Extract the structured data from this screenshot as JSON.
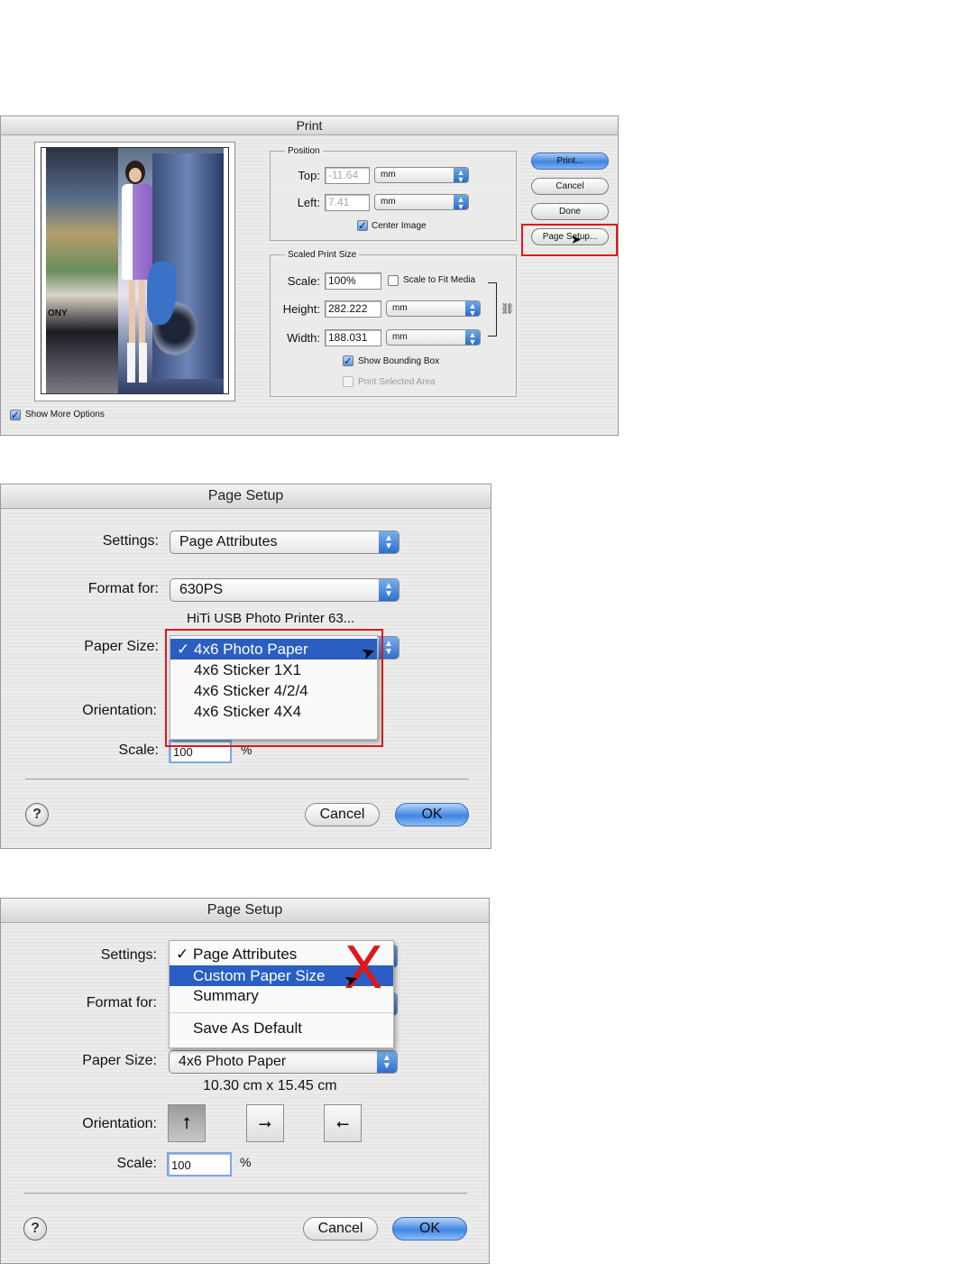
{
  "print_dialog": {
    "title": "Print",
    "show_more_options": "Show More Options",
    "position": {
      "group_title": "Position",
      "top_label": "Top:",
      "top_value": "-11.64",
      "top_unit": "mm",
      "left_label": "Left:",
      "left_value": "7.41",
      "left_unit": "mm",
      "center_image": "Center Image"
    },
    "scaled_size": {
      "group_title": "Scaled Print Size",
      "scale_label": "Scale:",
      "scale_value": "100%",
      "scale_to_fit": "Scale to Fit Media",
      "height_label": "Height:",
      "height_value": "282.222",
      "height_unit": "mm",
      "width_label": "Width:",
      "width_value": "188.031",
      "width_unit": "mm",
      "show_bounding_box": "Show Bounding Box",
      "print_selected_area": "Print Selected Area"
    },
    "buttons": {
      "print": "Print...",
      "cancel": "Cancel",
      "done": "Done",
      "page_setup": "Page Setup..."
    },
    "preview_brand_text": "ONY"
  },
  "page_setup_1": {
    "title": "Page Setup",
    "settings_label": "Settings:",
    "settings_value": "Page Attributes",
    "format_label": "Format for:",
    "format_value": "630PS",
    "printer_desc": "HiTi USB Photo Printer 63...",
    "paper_label": "Paper Size:",
    "paper_options": [
      "4x6 Photo Paper",
      "4x6 Sticker 1X1",
      "4x6 Sticker 4/2/4",
      "4x6 Sticker 4X4"
    ],
    "checkmark": "✓",
    "orientation_label": "Orientation:",
    "scale_label": "Scale:",
    "scale_value": "100",
    "percent": "%",
    "help": "?",
    "cancel": "Cancel",
    "ok": "OK"
  },
  "page_setup_2": {
    "title": "Page Setup",
    "settings_label": "Settings:",
    "settings_options": [
      "Page Attributes",
      "Custom Paper Size",
      "Summary",
      "Save As Default"
    ],
    "checkmark": "✓",
    "format_label": "Format for:",
    "paper_label": "Paper Size:",
    "paper_value": "4x6 Photo Paper",
    "paper_dims": "10.30 cm x 15.45 cm",
    "orientation_label": "Orientation:",
    "scale_label": "Scale:",
    "scale_value": "100",
    "percent": "%",
    "help": "?",
    "cancel": "Cancel",
    "ok": "OK",
    "annotation_mark": "X"
  },
  "colors": {
    "highlight_red": "#e0161b",
    "selection_blue": "#2b5ec2",
    "aqua_blue": "#3f83e0"
  }
}
